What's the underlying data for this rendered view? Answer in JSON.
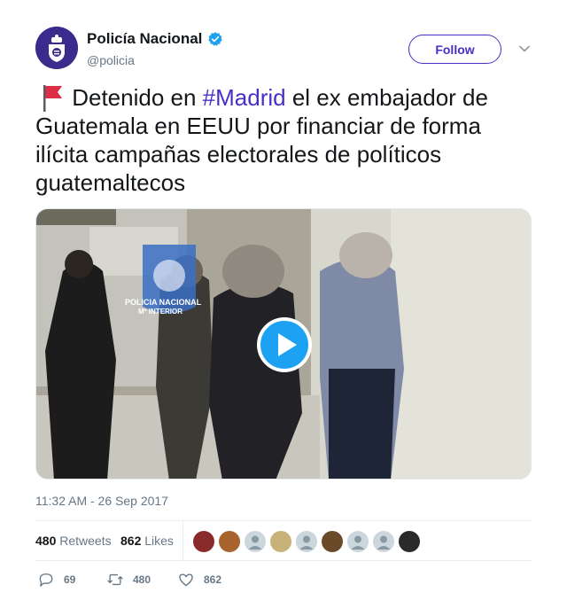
{
  "tweet": {
    "author": {
      "display_name": "Policía Nacional",
      "handle": "@policia",
      "verified": true,
      "avatar_icon": "policia-nacional-shield-logo"
    },
    "follow_label": "Follow",
    "text_parts": [
      {
        "type": "emoji",
        "icon": "red-flag-icon"
      },
      {
        "type": "text",
        "value": " Detenido en "
      },
      {
        "type": "hashtag",
        "value": "#Madrid"
      },
      {
        "type": "text",
        "value": " el ex embajador de Guatemala en EEUU por financiar de forma ilícita campañas electorales de políticos guatemaltecos"
      }
    ],
    "media": {
      "type": "video",
      "overlay_watermark": [
        "POLICIA NACIONAL",
        "Mº INTERIOR"
      ],
      "play_icon": "play-icon"
    },
    "timestamp": "11:32 AM - 26 Sep 2017",
    "stats": {
      "retweets_count": "480",
      "retweets_label": "Retweets",
      "likes_count": "862",
      "likes_label": "Likes"
    },
    "actions": {
      "reply_count": "69",
      "retweet_count": "480",
      "like_count": "862"
    }
  },
  "colors": {
    "accent": "#4a2ec9",
    "verified": "#1da1f2",
    "muted": "#657786",
    "text": "#14171a"
  }
}
